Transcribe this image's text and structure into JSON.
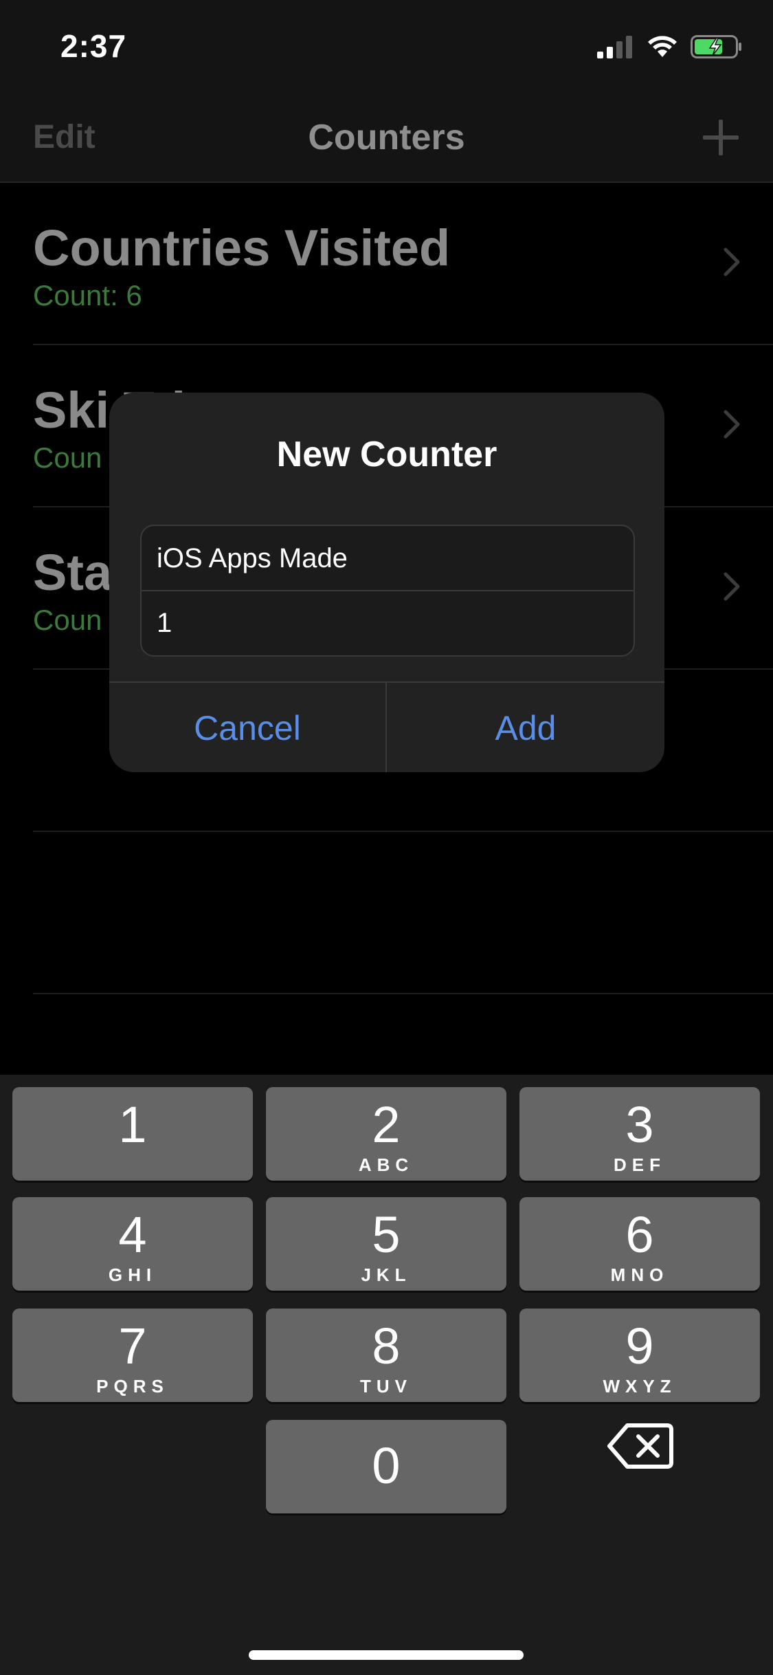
{
  "status_bar": {
    "time": "2:37"
  },
  "nav": {
    "edit_label": "Edit",
    "title": "Counters",
    "add_icon": "plus-icon"
  },
  "counters": [
    {
      "title": "Countries Visited",
      "count": "Count: 6"
    },
    {
      "title": "Ski Tri",
      "count": "Coun"
    },
    {
      "title": "Sta",
      "count": "Coun"
    }
  ],
  "dialog": {
    "title": "New Counter",
    "name_value": "iOS Apps Made",
    "count_value": "1",
    "cancel_label": "Cancel",
    "add_label": "Add"
  },
  "keyboard": {
    "keys": [
      {
        "digit": "1",
        "letters": ""
      },
      {
        "digit": "2",
        "letters": "ABC"
      },
      {
        "digit": "3",
        "letters": "DEF"
      },
      {
        "digit": "4",
        "letters": "GHI"
      },
      {
        "digit": "5",
        "letters": "JKL"
      },
      {
        "digit": "6",
        "letters": "MNO"
      },
      {
        "digit": "7",
        "letters": "PQRS"
      },
      {
        "digit": "8",
        "letters": "TUV"
      },
      {
        "digit": "9",
        "letters": "WXYZ"
      },
      {
        "digit": "0",
        "letters": ""
      }
    ],
    "delete_icon": "backspace-icon"
  },
  "colors": {
    "accent": "#5a8ee6",
    "count_green": "#3b7a3b",
    "battery_green": "#4cd964"
  }
}
